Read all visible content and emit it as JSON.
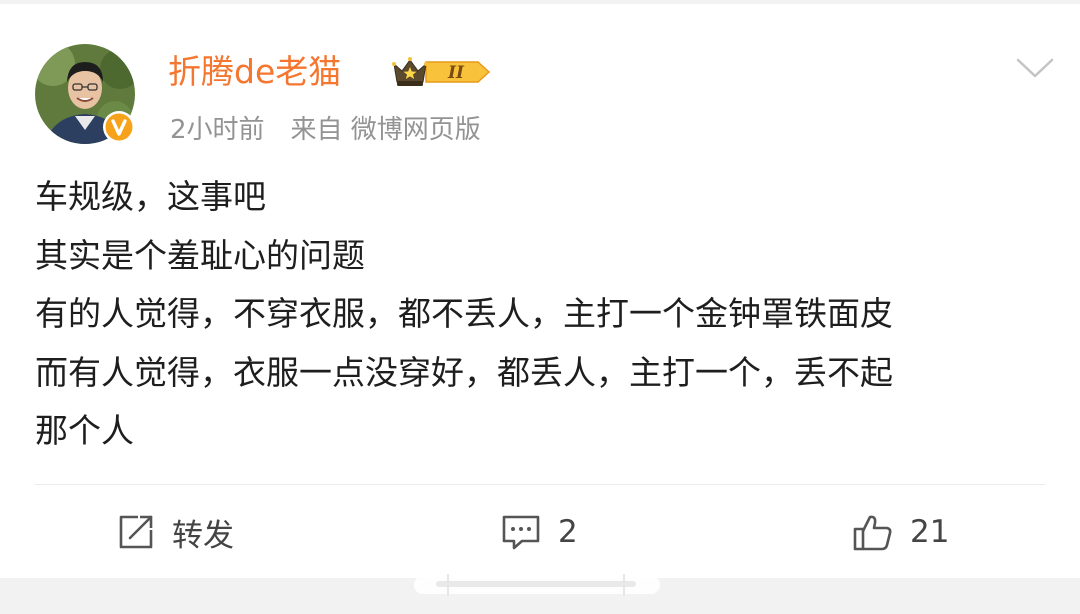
{
  "post": {
    "author": {
      "name": "折腾de老猫",
      "avatar_icon": "user-avatar-photo",
      "verified_icon": "verified-v-badge",
      "vip_level_icon": "crown-level-II-badge"
    },
    "meta": {
      "time": "2小时前",
      "source": "来自 微博网页版"
    },
    "body": {
      "lines": [
        "车规级，这事吧",
        "其实是个羞耻心的问题",
        "有的人觉得，不穿衣服，都不丢人，主打一个金钟罩铁面皮",
        "而有人觉得，衣服一点没穿好，都丢人，主打一个，丢不起",
        "那个人"
      ]
    },
    "actions": {
      "repost_label": "转发",
      "comment_count": "2",
      "like_count": "21"
    }
  },
  "colors": {
    "username": "#f4762f",
    "verified": "#f7a21b",
    "meta": "#939393",
    "body_text": "#1e1e1e"
  }
}
